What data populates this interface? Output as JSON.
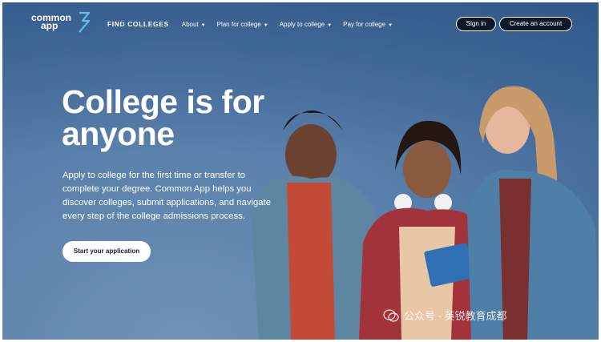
{
  "header": {
    "logo_line1": "common",
    "logo_line2": "app",
    "nav": [
      {
        "label": "FIND COLLEGES"
      },
      {
        "label": "About",
        "caret": "▼"
      },
      {
        "label": "Plan for college",
        "caret": "▼"
      },
      {
        "label": "Apply to college",
        "caret": "▼"
      },
      {
        "label": "Pay for college",
        "caret": "▼"
      }
    ],
    "signin_label": "Sign in",
    "create_label": "Create an account"
  },
  "hero": {
    "title": "College is for anyone",
    "subtitle": "Apply to college for the first time or transfer to complete your degree. Common App helps you discover colleges, submit applications, and navigate every step of the college admissions process.",
    "cta_label": "Start your application"
  },
  "watermark": "公众号 · 英锐教育成都",
  "colors": {
    "background": "#5a80aa",
    "button_dark": "#0e1a2b",
    "text_white": "#ffffff",
    "logo_accent": "#5bc0eb"
  },
  "icons": [
    "common-app-logo-mark",
    "caret-down-icon",
    "wechat-icon"
  ]
}
